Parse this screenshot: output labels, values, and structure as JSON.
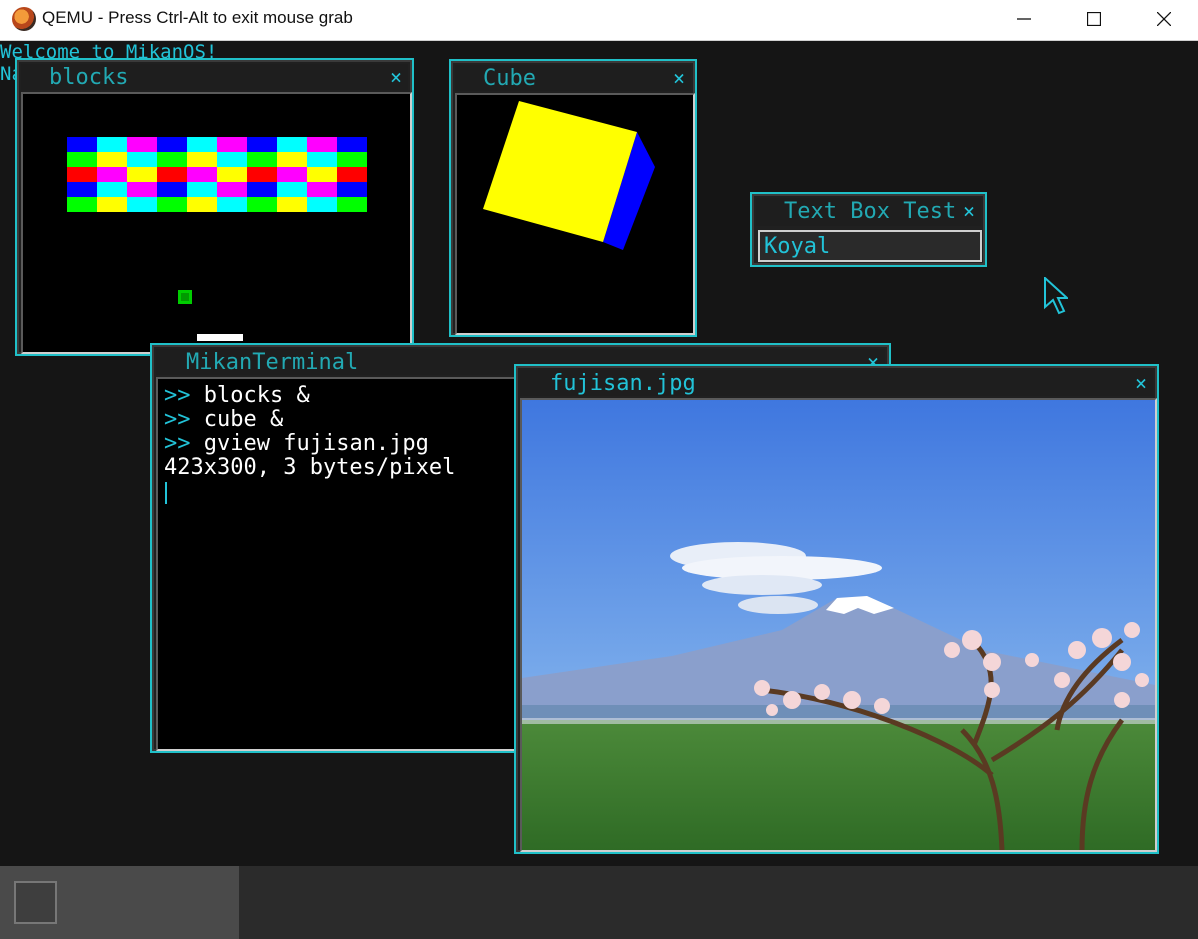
{
  "window": {
    "title": "QEMU - Press Ctrl-Alt to exit mouse grab"
  },
  "console": {
    "line1": "Welcome to MikanOS!",
    "line2": "Na"
  },
  "blocks": {
    "title": "blocks",
    "close_glyph": "×",
    "colors": {
      "blue": "#0000ff",
      "cyan": "#00ffff",
      "magenta": "#ff00ff",
      "green": "#00ff00",
      "yellow": "#ffff00",
      "red": "#ff0000"
    },
    "rows": [
      [
        "blue",
        "cyan",
        "magenta",
        "blue",
        "cyan",
        "magenta",
        "blue",
        "cyan",
        "magenta",
        "blue"
      ],
      [
        "green",
        "yellow",
        "cyan",
        "green",
        "yellow",
        "cyan",
        "green",
        "yellow",
        "cyan",
        "green"
      ],
      [
        "red",
        "magenta",
        "yellow",
        "red",
        "magenta",
        "yellow",
        "red",
        "magenta",
        "yellow",
        "red"
      ],
      [
        "blue",
        "cyan",
        "magenta",
        "blue",
        "cyan",
        "magenta",
        "blue",
        "cyan",
        "magenta",
        "blue"
      ],
      [
        "green",
        "yellow",
        "cyan",
        "green",
        "yellow",
        "cyan",
        "green",
        "yellow",
        "cyan",
        "green"
      ]
    ]
  },
  "cube": {
    "title": "Cube",
    "close_glyph": "×",
    "face_color": "#ffff00",
    "side_color": "#0000ff"
  },
  "textbox": {
    "title": "Text Box Test",
    "close_glyph": "×",
    "value": "Koyal"
  },
  "terminal": {
    "title": "MikanTerminal",
    "close_glyph": "×",
    "lines": [
      {
        "prompt": ">> ",
        "text": "blocks &"
      },
      {
        "prompt": ">> ",
        "text": "cube &"
      },
      {
        "prompt": ">> ",
        "text": "gview fujisan.jpg"
      },
      {
        "prompt": "",
        "text": "423x300, 3 bytes/pixel"
      }
    ]
  },
  "gview": {
    "title": "fujisan.jpg",
    "close_glyph": "×"
  },
  "accent_color": "#20c0c8"
}
